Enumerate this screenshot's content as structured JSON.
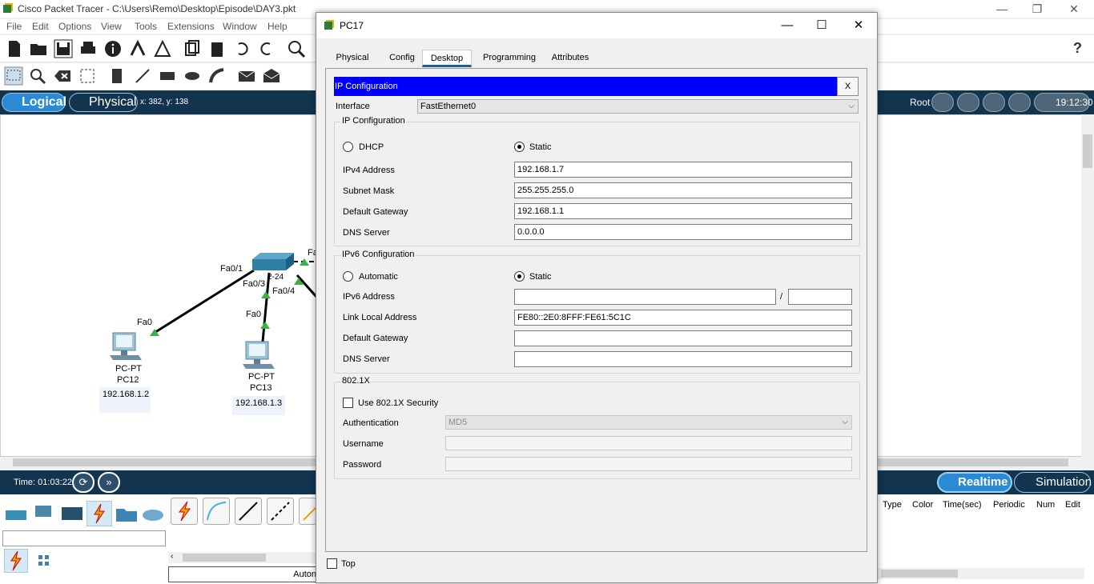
{
  "app": {
    "title": "Cisco Packet Tracer - C:\\Users\\Remo\\Desktop\\Episode\\DAY3.pkt",
    "menu": [
      "File",
      "Edit",
      "Options",
      "View",
      "Tools",
      "Extensions",
      "Window",
      "Help"
    ]
  },
  "modebar": {
    "logical": "Logical",
    "physical": "Physical",
    "coords": "x: 382, y: 138",
    "root": "Root",
    "clock": "19:12:30"
  },
  "topology": {
    "devices": [
      {
        "type": "PC-PT",
        "name": "PC12",
        "ip": "192.168.1.2"
      },
      {
        "type": "PC-PT",
        "name": "PC13",
        "ip": "192.168.1.3"
      }
    ],
    "port_labels": [
      "Fa0/1",
      "Fa0/3",
      "Fa0/4",
      "Fa0",
      "Fa0",
      "Fa",
      "2-24"
    ]
  },
  "timebar": {
    "time": "Time: 01:03:22",
    "realtime": "Realtime",
    "simulation": "Simulation"
  },
  "pdu_columns": [
    "Type",
    "Color",
    "Time(sec)",
    "Periodic",
    "Num",
    "Edit"
  ],
  "bottom": {
    "auto": "Auton"
  },
  "dialog": {
    "title": "PC17",
    "tabs": [
      "Physical",
      "Config",
      "Desktop",
      "Programming",
      "Attributes"
    ],
    "active_tab": "Desktop",
    "header": "IP Configuration",
    "close": "X",
    "interface_label": "Interface",
    "interface_value": "FastEthernet0",
    "ipv4": {
      "group_title": "IP Configuration",
      "dhcp": "DHCP",
      "static": "Static",
      "mode": "Static",
      "address_label": "IPv4 Address",
      "address": "192.168.1.7",
      "mask_label": "Subnet Mask",
      "mask": "255.255.255.0",
      "gateway_label": "Default Gateway",
      "gateway": "192.168.1.1",
      "dns_label": "DNS Server",
      "dns": "0.0.0.0"
    },
    "ipv6": {
      "group_title": "IPv6 Configuration",
      "automatic": "Automatic",
      "static": "Static",
      "mode": "Static",
      "address_label": "IPv6 Address",
      "address": "",
      "slash": "/",
      "prefix": "",
      "link_local_label": "Link Local Address",
      "link_local": "FE80::2E0:8FFF:FE61:5C1C",
      "gateway_label": "Default Gateway",
      "gateway": "",
      "dns_label": "DNS Server",
      "dns": ""
    },
    "dot1x": {
      "group_title": "802.1X",
      "use_label": "Use 802.1X Security",
      "use": false,
      "auth_label": "Authentication",
      "auth": "MD5",
      "username_label": "Username",
      "username": "",
      "password_label": "Password",
      "password": ""
    },
    "top_label": "Top"
  }
}
